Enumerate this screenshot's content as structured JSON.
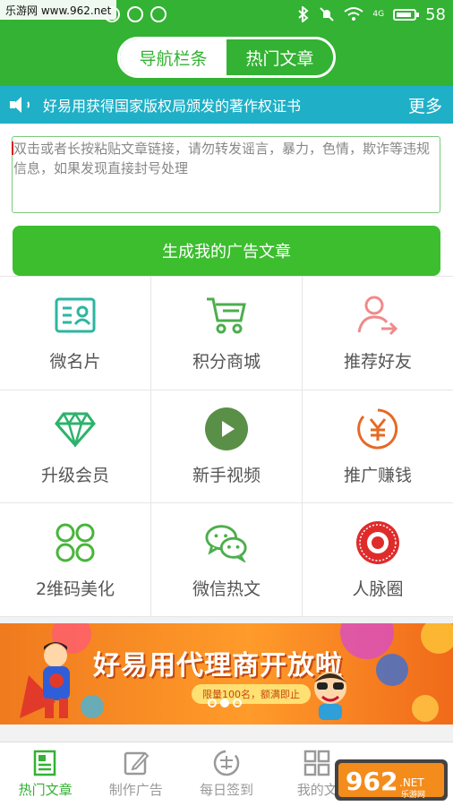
{
  "status_bar": {
    "watermark": "乐游网 www.962.net",
    "battery_level": "58",
    "network": "4G"
  },
  "header": {
    "tabs": [
      {
        "label": "导航栏条",
        "active": false
      },
      {
        "label": "热门文章",
        "active": true
      }
    ]
  },
  "notice": {
    "text": "好易用获得国家版权局颁发的著作权证书",
    "more_label": "更多"
  },
  "article_input": {
    "placeholder": "双击或者长按粘贴文章链接，请勿转发谣言，暴力，色情，欺诈等违规信息，如果发现直接封号处理"
  },
  "generate_button": {
    "label": "生成我的广告文章"
  },
  "features": [
    {
      "label": "微名片",
      "icon": "business-card-icon",
      "color": "#2bb6a0"
    },
    {
      "label": "积分商城",
      "icon": "shopping-cart-icon",
      "color": "#4cae4c"
    },
    {
      "label": "推荐好友",
      "icon": "invite-friend-icon",
      "color": "#f08a8a"
    },
    {
      "label": "升级会员",
      "icon": "diamond-icon",
      "color": "#2cb36b"
    },
    {
      "label": "新手视频",
      "icon": "play-video-icon",
      "color": "#5a8f48"
    },
    {
      "label": "推广赚钱",
      "icon": "yuan-coin-icon",
      "color": "#e56a24"
    },
    {
      "label": "2维码美化",
      "icon": "clover-icon",
      "color": "#48b53a"
    },
    {
      "label": "微信热文",
      "icon": "wechat-icon",
      "color": "#4cae4c"
    },
    {
      "label": "人脉圈",
      "icon": "target-ring-icon",
      "color": "#e02b2b"
    }
  ],
  "banner": {
    "title": "好易用代理商开放啦",
    "subtitle": "限量100名，额满即止",
    "slide_index": 2,
    "slide_count": 3
  },
  "bottom_nav": [
    {
      "label": "热门文章",
      "icon": "article-icon",
      "active": true
    },
    {
      "label": "制作广告",
      "icon": "edit-icon",
      "active": false
    },
    {
      "label": "每日签到",
      "icon": "sign-in-icon",
      "active": false
    },
    {
      "label": "我的文",
      "icon": "grid-icon",
      "active": false
    }
  ],
  "logo": {
    "text": "962",
    "sub": "乐游网"
  },
  "colors": {
    "brand_green": "#33b233",
    "notice_blue": "#1fb0c7",
    "button_green": "#3cbe2f"
  }
}
